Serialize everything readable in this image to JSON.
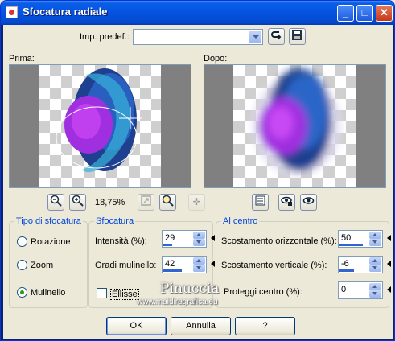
{
  "window": {
    "title": "Sfocatura radiale"
  },
  "titlebar_buttons": {
    "minimize": "_",
    "maximize": "□",
    "close": "✕"
  },
  "preset": {
    "label": "Imp. predef.:",
    "value": ""
  },
  "preview": {
    "before_label": "Prima:",
    "after_label": "Dopo:",
    "zoom": "18,75%"
  },
  "tipo": {
    "legend": "Tipo di sfocatura",
    "options": [
      "Rotazione",
      "Zoom",
      "Mulinello"
    ],
    "selected": "Mulinello"
  },
  "sfocatura": {
    "legend": "Sfocatura",
    "intensita_label": "Intensità (%):",
    "intensita_value": "29",
    "intensita_fraction": 0.29,
    "gradi_label": "Gradi mulinello:",
    "gradi_value": "42",
    "gradi_fraction": 0.6,
    "ellisse_label": "Ellisse",
    "ellisse_checked": false
  },
  "centro": {
    "legend": "Al centro",
    "orizz_label": "Scostamento orizzontale (%):",
    "orizz_value": "50",
    "orizz_fraction": 0.75,
    "vert_label": "Scostamento verticale (%):",
    "vert_value": "-6",
    "vert_fraction": 0.47,
    "proteggi_label": "Proteggi centro (%):",
    "proteggi_value": "0",
    "proteggi_fraction": 0
  },
  "buttons": {
    "ok": "OK",
    "annulla": "Annulla",
    "help": "?"
  },
  "watermark": {
    "name": "Pinuccia",
    "url": "www.maidiregrafica.eu"
  },
  "colors": {
    "title_bar": "#0553e0",
    "legend_text": "#0046d5",
    "radio_dot": "#21a121",
    "slider_bar": "#3263cf"
  }
}
